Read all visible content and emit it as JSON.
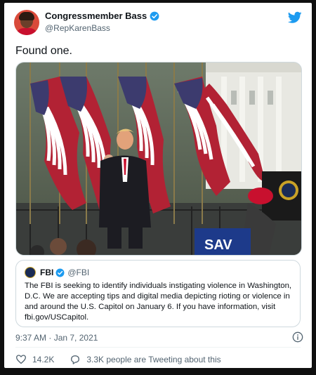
{
  "tweet": {
    "display_name": "Congressmember Bass",
    "handle": "@RepKarenBass",
    "text": "Found one.",
    "timestamp": "9:37 AM · Jan 7, 2021",
    "likes": "14.2K",
    "tweeting_about": "3.3K people are Tweeting about this"
  },
  "quoted_tweet": {
    "name": "FBI",
    "handle": "@FBI",
    "text": "The FBI is seeking to identify individuals instigating violence in Washington, D.C. We are accepting tips and digital media depicting rioting or violence in and around the U.S. Capitol on January 6. If you have information, visit fbi.gov/USCapitol."
  },
  "photo": {
    "sign_text": "SAV"
  },
  "icons": {
    "brand": "twitter-bird-icon",
    "verified": "verified-badge-icon",
    "info": "info-icon",
    "like": "heart-icon",
    "reply": "speech-bubble-icon"
  },
  "colors": {
    "twitter_blue": "#1d9bf0",
    "text_secondary": "#536471",
    "border": "#cfd9de"
  }
}
